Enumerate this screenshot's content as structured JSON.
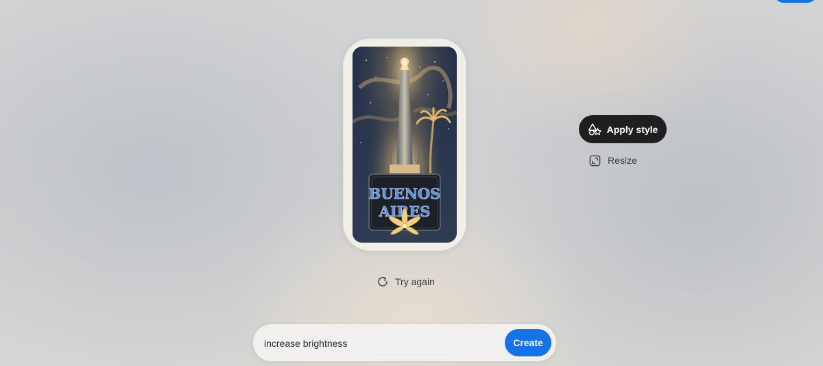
{
  "poster": {
    "title_line1": "BUENOS",
    "title_line2": "AIRES"
  },
  "actions": {
    "try_again_label": "Try again",
    "apply_style_label": "Apply style",
    "resize_label": "Resize"
  },
  "prompt": {
    "value": "increase brightness",
    "create_label": "Create"
  },
  "colors": {
    "accent": "#1473e6",
    "dark_button": "#1f1f1f"
  },
  "icons": {
    "try_again": "refresh-icon",
    "apply_style": "shapes-icon",
    "resize": "resize-icon"
  }
}
